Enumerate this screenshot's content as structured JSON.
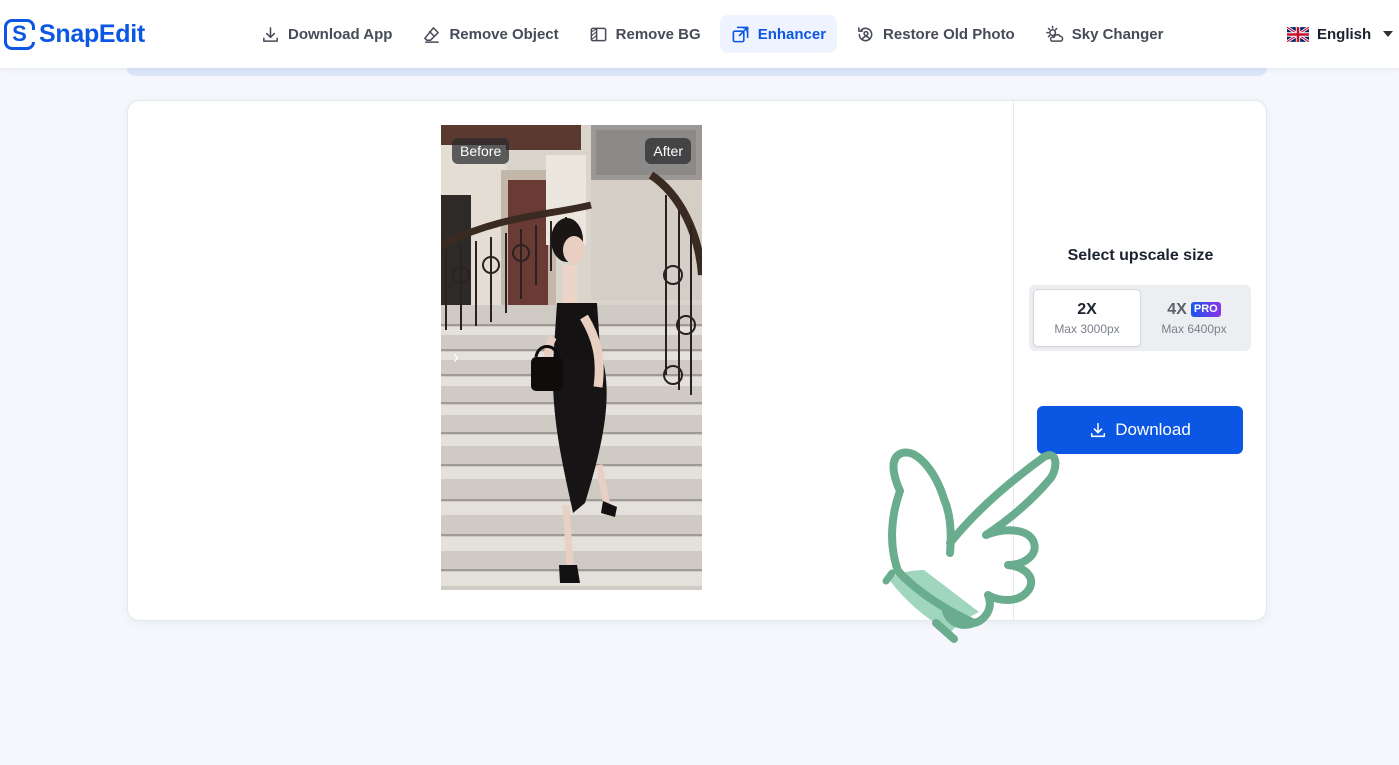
{
  "brand": {
    "name": "SnapEdit",
    "mark": "S"
  },
  "nav": {
    "items": [
      {
        "label": "Download App",
        "icon": "download-icon"
      },
      {
        "label": "Remove Object",
        "icon": "eraser-icon"
      },
      {
        "label": "Remove BG",
        "icon": "remove-bg-icon"
      },
      {
        "label": "Enhancer",
        "icon": "enhance-icon",
        "active": true
      },
      {
        "label": "Restore Old Photo",
        "icon": "restore-icon"
      },
      {
        "label": "Sky Changer",
        "icon": "sky-icon"
      }
    ]
  },
  "language": {
    "label": "English",
    "flag": "uk-flag-icon"
  },
  "editor": {
    "before_label": "Before",
    "after_label": "After",
    "slider_icon": "chevron-right-icon"
  },
  "panel": {
    "title": "Select upscale size",
    "options": [
      {
        "label": "2X",
        "sub": "Max 3000px",
        "selected": true
      },
      {
        "label": "4X",
        "sub": "Max 6400px",
        "badge": "PRO",
        "selected": false
      }
    ],
    "download_label": "Download"
  },
  "colors": {
    "accent": "#0b57e3",
    "active_nav_bg": "#eef3ff",
    "page_bg": "#f5f7fc",
    "hand_cursor": "#6aad8e"
  }
}
